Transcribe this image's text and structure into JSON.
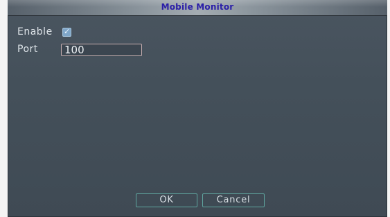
{
  "dialog": {
    "title": "Mobile Monitor"
  },
  "form": {
    "enable_label": "Enable",
    "enable_checked": true,
    "port_label": "Port",
    "port_value": "100"
  },
  "buttons": {
    "ok": "OK",
    "cancel": "Cancel"
  },
  "colors": {
    "title_text": "#2a1ea8",
    "button_border": "#5fa6a0",
    "panel_bg": "#44505a"
  }
}
